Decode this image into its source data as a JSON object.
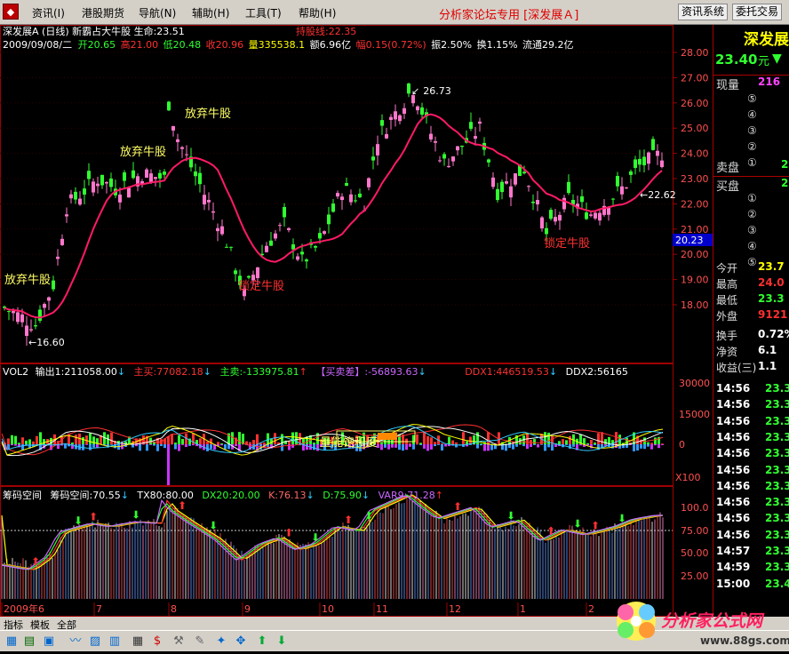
{
  "menu": {
    "items": [
      "资讯(I)",
      "港股期货",
      "导航(N)",
      "辅助(H)",
      "工具(T)",
      "帮助(H)"
    ],
    "banner": "分析家论坛专用 [深发展Ａ]",
    "buttons": [
      "资讯系统",
      "委托交易"
    ]
  },
  "main_header": {
    "title": "深发展A (日线) 新霸占大牛股 生命:23.51",
    "hold_line": "持股线:22.35",
    "date": "2009/09/08/二",
    "open": "开20.65",
    "high": "高21.00",
    "low": "低20.48",
    "close": "收20.96",
    "volume": "量335538.1",
    "amount": "额6.96亿",
    "change": "幅0.15(0.72%)",
    "amplitude": "振2.50%",
    "turnover": "换1.15%",
    "float": "流通29.2亿"
  },
  "annotations": {
    "abandon1": "放弃牛股",
    "abandon2": "放弃牛股",
    "abandon3": "放弃牛股",
    "lock1": "锁定牛股",
    "lock2": "锁定牛股",
    "high_mark": "26.73",
    "low_mark": "16.60",
    "price_mark": "22.62",
    "cursor_price": "20.23",
    "volume_sat": "量能饱和度"
  },
  "vol_header": {
    "name": "VOL2",
    "out1": "输出1:211058.00",
    "buy": "主买:77082.18",
    "sell": "主卖:-133975.81",
    "diff": "【买卖差】:-56893.63",
    "ddx1": "DDX1:446519.53",
    "ddx2": "DDX2:56165"
  },
  "chip_header": {
    "name": "筹码空间",
    "chip": "筹码空间:70.55",
    "tx80": "TX80:80.00",
    "dx20": "DX20:20.00",
    "k": "K:76.13",
    "d": "D:75.90",
    "var9": "VAR9:71.28"
  },
  "axis": {
    "price_ticks": [
      "28.00",
      "27.00",
      "26.00",
      "25.00",
      "24.00",
      "23.00",
      "22.00",
      "21.00",
      "20.00",
      "19.00",
      "18.00"
    ],
    "vol_ticks": [
      "30000",
      "15000",
      "0"
    ],
    "vol_scale": "X100",
    "chip_ticks": [
      "100.0",
      "75.00",
      "50.00",
      "25.00"
    ],
    "months": [
      "2009年6",
      "7",
      "8",
      "9",
      "10",
      "11",
      "12",
      "1",
      "2"
    ]
  },
  "quote": {
    "name": "深发展",
    "price": "23.40",
    "unit": "元",
    "now_label": "现量",
    "now_val": "216",
    "sell_label": "卖盘",
    "buy_label": "买盘",
    "sell_levels": [
      "⑤",
      "④",
      "③",
      "②",
      "①"
    ],
    "buy_levels": [
      "①",
      "②",
      "③",
      "④",
      "⑤"
    ],
    "sell1": "2",
    "buy1": "2",
    "stats": [
      {
        "label": "今开",
        "value": "23.7",
        "color": "#ffff00"
      },
      {
        "label": "最高",
        "value": "24.0",
        "color": "#ff3030"
      },
      {
        "label": "最低",
        "value": "23.3",
        "color": "#30ff30"
      },
      {
        "label": "外盘",
        "value": "9121",
        "color": "#ff3030"
      },
      {
        "label": "换手",
        "value": "0.72%",
        "color": "#ffffff"
      },
      {
        "label": "净资",
        "value": "6.1",
        "color": "#ffffff"
      },
      {
        "label": "收益(三)",
        "value": "1.1",
        "color": "#ffffff"
      }
    ],
    "ticks": [
      {
        "time": "14:56",
        "price": "23.3"
      },
      {
        "time": "14:56",
        "price": "23.3"
      },
      {
        "time": "14:56",
        "price": "23.3"
      },
      {
        "time": "14:56",
        "price": "23.3"
      },
      {
        "time": "14:56",
        "price": "23.3"
      },
      {
        "time": "14:56",
        "price": "23.3"
      },
      {
        "time": "14:56",
        "price": "23.3"
      },
      {
        "time": "14:56",
        "price": "23.3"
      },
      {
        "time": "14:56",
        "price": "23.3"
      },
      {
        "time": "14:56",
        "price": "23.3"
      },
      {
        "time": "14:57",
        "price": "23.3"
      },
      {
        "time": "14:59",
        "price": "23.3"
      },
      {
        "time": "15:00",
        "price": "23.4"
      }
    ]
  },
  "bottom": {
    "tabs": [
      "指标",
      "模板",
      "全部"
    ]
  },
  "watermark": {
    "title": "分析家公式网",
    "url": "www.88gs.com"
  },
  "colors": {
    "up": "#ff3030",
    "down": "#30ff30",
    "candle_up": "#ff77cc",
    "ma": "#ff1a66",
    "panel_border": "#a00000"
  }
}
